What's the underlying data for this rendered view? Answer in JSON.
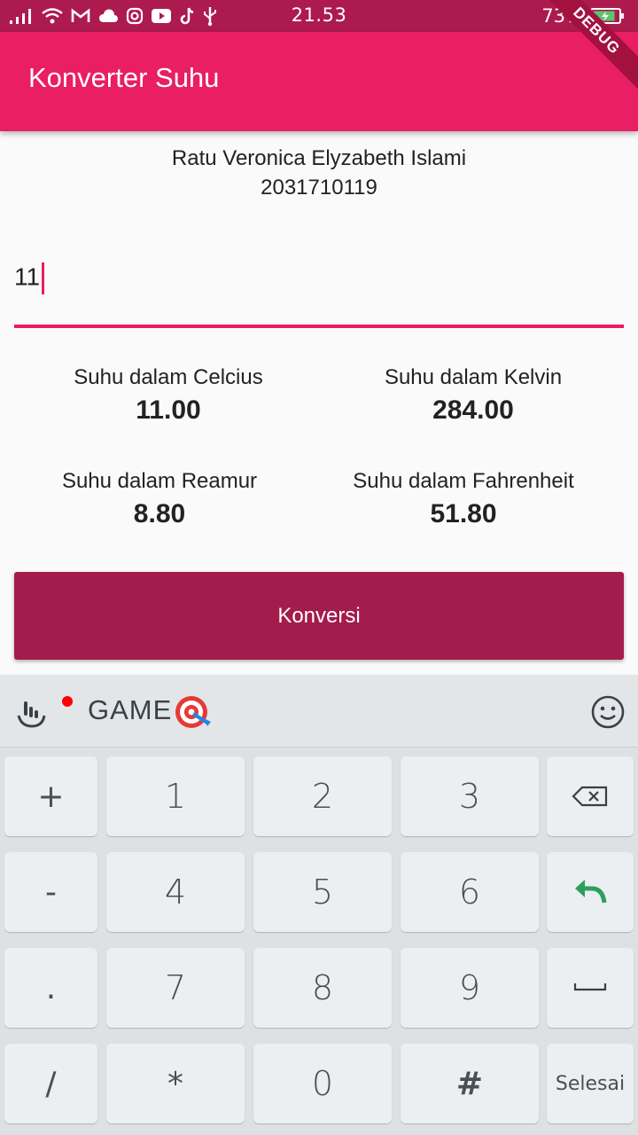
{
  "status_bar": {
    "time": "21.53",
    "battery": "73%",
    "left_icons": [
      "signal-icon",
      "wifi-icon",
      "gmail-icon",
      "cloud-icon",
      "instagram-icon",
      "youtube-icon",
      "tiktok-icon",
      "usb-icon"
    ],
    "color": "#ad1a4e"
  },
  "app_bar": {
    "title": "Konverter Suhu",
    "debug_banner": "DEBUG",
    "color": "#e91e63"
  },
  "identity": {
    "name": "Ratu Veronica Elyzabeth Islami",
    "nim": "2031710119"
  },
  "input": {
    "value": "11"
  },
  "results": {
    "celcius": {
      "label": "Suhu dalam Celcius",
      "value": "11.00"
    },
    "kelvin": {
      "label": "Suhu dalam Kelvin",
      "value": "284.00"
    },
    "reamur": {
      "label": "Suhu dalam Reamur",
      "value": "8.80"
    },
    "fahrenheit": {
      "label": "Suhu dalam Fahrenheit",
      "value": "51.80"
    }
  },
  "convert_button": {
    "label": "Konversi",
    "color": "#a31c4c"
  },
  "keyboard": {
    "toolbar_label": "GAME",
    "rows": [
      [
        "+",
        "1",
        "2",
        "3",
        "backspace"
      ],
      [
        "-",
        "4",
        "5",
        "6",
        "enter"
      ],
      [
        ".",
        "7",
        "8",
        "9",
        "space"
      ],
      [
        "/",
        "*",
        "0",
        "#",
        "Selesai"
      ]
    ],
    "keys": {
      "plus": "+",
      "one": "1",
      "two": "2",
      "three": "3",
      "minus": "-",
      "four": "4",
      "five": "5",
      "six": "6",
      "dot": ".",
      "seven": "7",
      "eight": "8",
      "nine": "9",
      "slash": "/",
      "star": "*",
      "zero": "0",
      "hash": "#",
      "done": "Selesai"
    }
  }
}
